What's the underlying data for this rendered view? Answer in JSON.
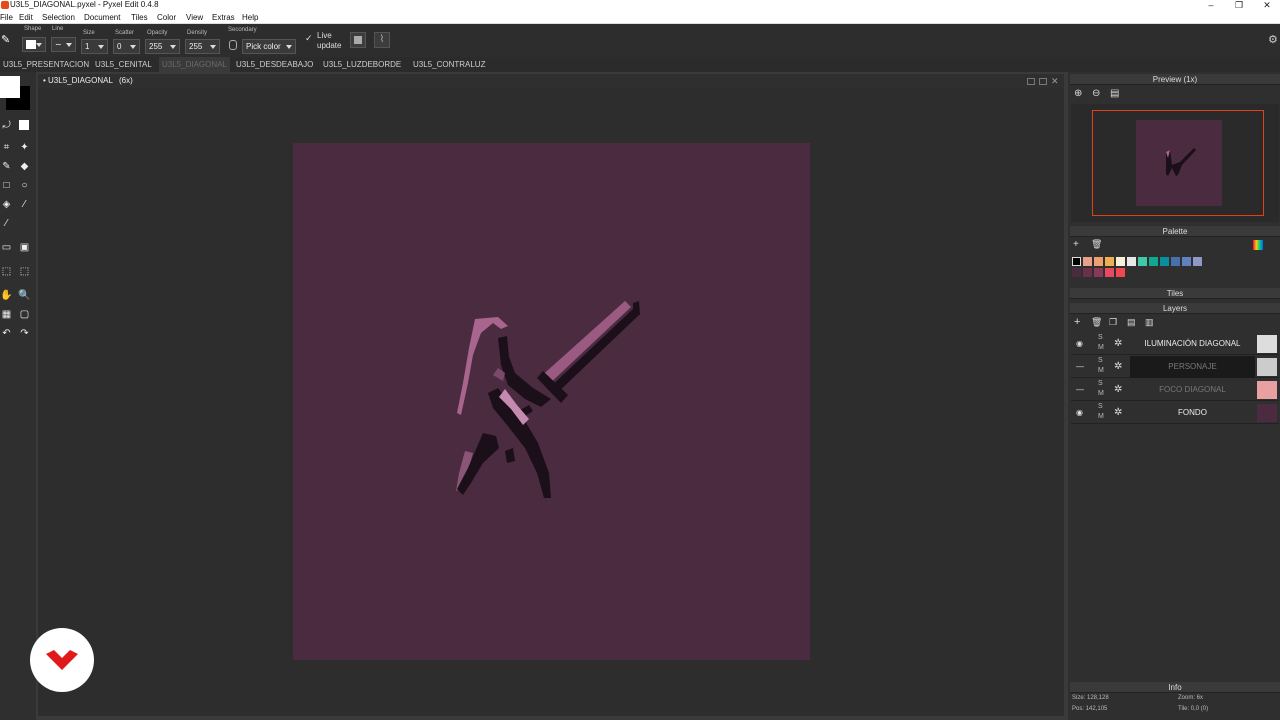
{
  "window": {
    "title": "U3L5_DIAGONAL.pyxel - Pyxel Edit 0.4.8"
  },
  "menu": [
    "File",
    "Edit",
    "Selection",
    "Document",
    "Tiles",
    "Color",
    "View",
    "Extras",
    "Help"
  ],
  "toolbar": {
    "shape_label": "Shape",
    "line_label": "Line",
    "size_label": "Size",
    "size_value": "1",
    "scatter_label": "Scatter",
    "scatter_value": "0",
    "opacity_label": "Opacity",
    "opacity_value": "255",
    "density_label": "Density",
    "density_value": "255",
    "secondary_label": "Secondary",
    "secondary_value": "Pick color",
    "live_update_label_1": "Live",
    "live_update_label_2": "update"
  },
  "tabs": [
    {
      "label": "U3L5_PRESENTACION",
      "active": false
    },
    {
      "label": "U3L5_CENITAL",
      "active": false
    },
    {
      "label": "U3L5_DIAGONAL",
      "active": true
    },
    {
      "label": "U3L5_DESDEABAJO",
      "active": false
    },
    {
      "label": "U3L5_LUZDEBORDE",
      "active": false
    },
    {
      "label": "U3L5_CONTRALUZ",
      "active": false
    }
  ],
  "document": {
    "title": "• U3L5_DIAGONAL",
    "zoom": "(6x)",
    "bg_color": "#4b2b40"
  },
  "preview": {
    "title": "Preview (1x)"
  },
  "palette": {
    "title": "Palette",
    "colors": [
      "#000000",
      "#e8a088",
      "#f0a070",
      "#f0b050",
      "#f8f0d8",
      "#e8e8e8",
      "#40c8a8",
      "#10a890",
      "#0890a0",
      "#4870a8",
      "#6080c0",
      "#9098c8",
      "#4b2b40",
      "#6a3048",
      "#8a3858",
      "#e84860",
      "#f04850"
    ]
  },
  "tiles": {
    "title": "Tiles"
  },
  "layers": {
    "title": "Layers",
    "items": [
      {
        "name": "ILUMINACIÓN DIAGONAL",
        "visible": true,
        "selected": false,
        "dim": false
      },
      {
        "name": "PERSONAJE",
        "visible": false,
        "selected": true,
        "dim": true
      },
      {
        "name": "FOCO DIAGONAL",
        "visible": false,
        "selected": false,
        "dim": true
      },
      {
        "name": "FONDO",
        "visible": true,
        "selected": false,
        "dim": false
      }
    ]
  },
  "info": {
    "title": "Info",
    "size": "Size: 128,128",
    "zoom": "Zoom: 6x",
    "pos": "Pos: 142,105",
    "tile": "Tile: 0,0 (0)"
  }
}
